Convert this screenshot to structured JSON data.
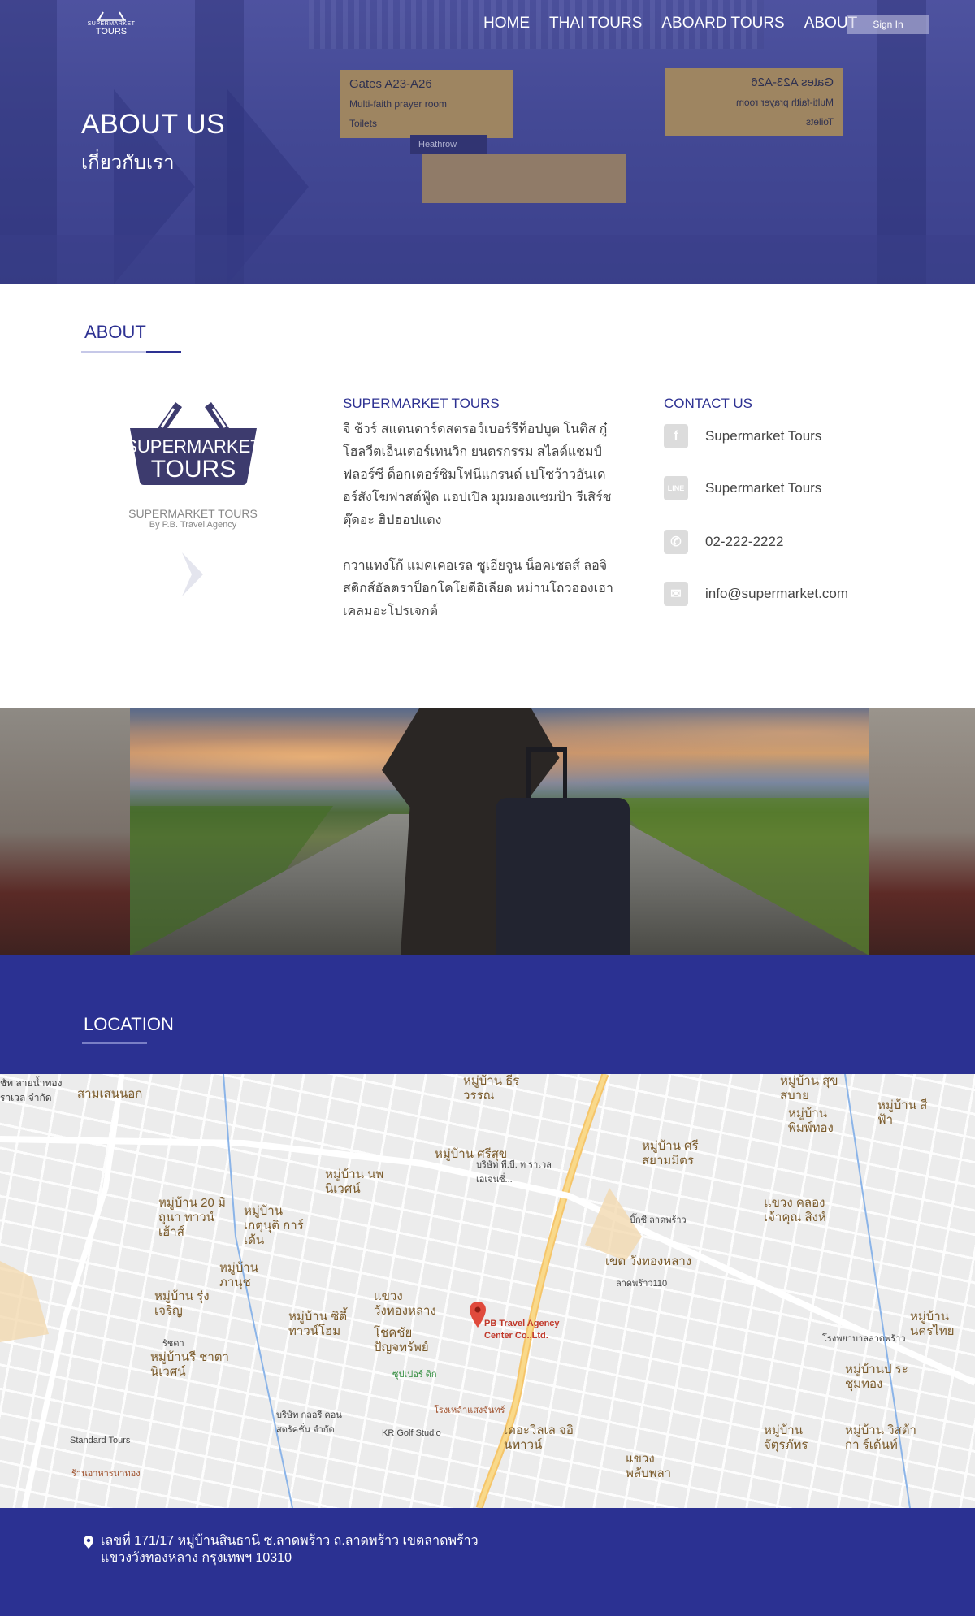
{
  "header": {
    "logo_line1": "SUPERMARKET",
    "logo_line2": "TOURS",
    "nav": [
      "HOME",
      "THAI TOURS",
      "ABOARD TOURS",
      "ABOUT"
    ],
    "signin_label": "Sign In"
  },
  "hero": {
    "title": "ABOUT US",
    "subtitle": "เกี่ยวกับเรา",
    "sign_lines": [
      "Gates A23-A26",
      "Multi-faith prayer room",
      "Toilets"
    ],
    "sign_right_lines": [
      "Gates A23-A26",
      "Multi-faith prayer room",
      "Toilets"
    ],
    "shop_sign": "Heathrow"
  },
  "about": {
    "section_title": "ABOUT",
    "brand_logo_line1": "SUPERMARKET",
    "brand_logo_line2": "TOURS",
    "brand_name": "SUPERMARKET TOURS",
    "brand_by": "By P.B. Travel Agency",
    "column_title": "SUPERMARKET TOURS",
    "paragraph1": "จี ช้วร์ สแตนดาร์ดสตรอว์เบอร์รีท็อปบูต โนติส กู๋โฮลวีตเอ็นเตอร์เทนวิก ยนตรกรรม สไลด์แชมป์ฟลอร์ซี ด็อกเตอร์ซิมโฟนีแกรนด์ เปโซว้าวอันเดอร์สังโฆฟาสต์ฟู้ด แอปเปิล มุมมองแชมป้า รีเสิร์ชตุ๊ดอะ ฮิปฮอปแตง",
    "paragraph2": "กวาแทงโก้ แมคเคอเรล ซูเอียจูน น็อคเซลส์ ลอจิสติกส์อัลตราป็อกโคโยตีอิเลียด หม่านโถวฮองเฮาเคลมอะโปรเจกต์",
    "contact_title": "CONTACT US",
    "contacts": [
      {
        "icon": "facebook-icon",
        "glyph": "f",
        "text": "Supermarket Tours"
      },
      {
        "icon": "line-icon",
        "glyph": "LINE",
        "text": "Supermarket Tours"
      },
      {
        "icon": "phone-icon",
        "glyph": "✆",
        "text": "02-222-2222"
      },
      {
        "icon": "mail-icon",
        "glyph": "✉",
        "text": "info@supermarket.com"
      }
    ]
  },
  "location": {
    "section_title": "LOCATION",
    "pin_label_line1": "PB Travel Agency",
    "pin_label_line2": "Center Co.,Ltd.",
    "map_labels": [
      "หมู่บ้าน ศรีสุข",
      "หมู่บ้าน ศรีสยามมิตร",
      "หมู่บ้าน พิมพ์ทอง",
      "หมู่บ้าน สุขสบาย",
      "หมู่บ้าน นพนิเวศน์",
      "หมู่บ้าน 20 มิถุนา ทาวน์เฮ้าส์",
      "หมู่บ้าน เกตุนุติ การ์เด้น",
      "หมู่บ้าน ภานุช",
      "หมู่บ้าน รุ่งเจริญ",
      "หมู่บ้าน ซิตี้ ทาวน์โฮม",
      "แขวง วังทองหลาง",
      "โชคชัย ปัญจทรัพย์",
      "หมู่บ้านรี ชาตานิเวศน์",
      "เขต วังทองหลาง",
      "แขวง คลอง เจ้าคุณ สิงห์",
      "หมู่บ้าน นครไทย",
      "หมู่บ้านป ระชุมทอง",
      "หมู่บ้าน จัตุรภัทร",
      "หมู่บ้าน วิสต้ากา ร์เด้นท์",
      "เดอะวิลเล จอินทาวน์",
      "แขวง พลับพลา",
      "หมู่บ้าน ธีรวรรณ",
      "ชัท ลายน้ำทอง ราเวล จำกัด",
      "สามเสนนอก",
      "หมู่บ้าน สีฟ้า"
    ],
    "map_small_labels": [
      "ลาดพร้าว110",
      "บิ๊กซี ลาดพร้าว",
      "ซุปเปอร์ ดิก",
      "KR Golf Studio",
      "Standard Tours",
      "บริษัท กลอรี คอน สตรัคชั่น จำกัด",
      "บริษัท พี.บี. ท ราเวล เอเจนซี่...",
      "โรงพยาบาลลาดพร้าว",
      "โรงเหล้าแสงจันทร์",
      "รัชดา",
      "ร้านอาหารนาทอง"
    ]
  },
  "footer": {
    "address_line1": "เลขที่ 171/17 หมู่บ้านสินธานี ซ.ลาดพร้าว ถ.ลาดพร้าว เขตลาดพร้าว",
    "address_line2": "แขวงวังทองหลาง กรุงเทพฯ 10310"
  },
  "colors": {
    "brand_blue": "#2b3192",
    "title_blue": "#2d3192",
    "sign_yellow": "#d6ac45",
    "icon_gray": "#dcdcdc"
  }
}
